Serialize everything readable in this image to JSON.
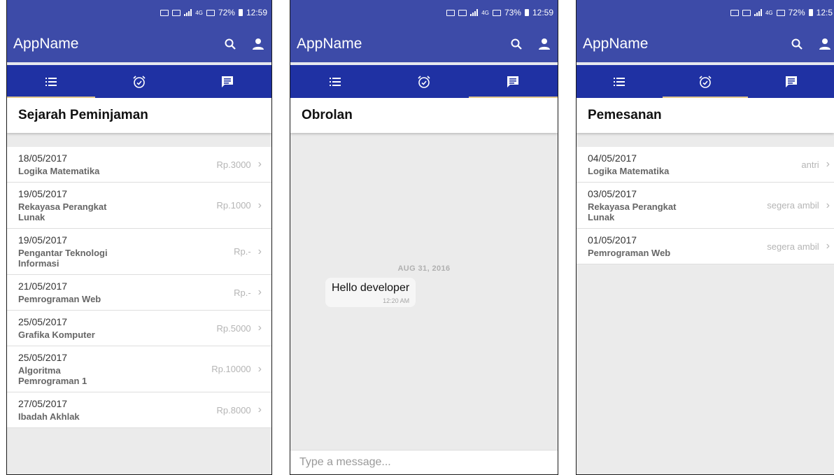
{
  "screens": [
    {
      "status": {
        "carrier": "4G",
        "battery": "72%",
        "time": "12:59"
      },
      "appbar": {
        "title": "AppName"
      },
      "tabs": [
        {
          "icon": "list-icon"
        },
        {
          "icon": "alarm-icon"
        },
        {
          "icon": "chat-icon"
        }
      ],
      "active_tab": 0,
      "section_title": "Sejarah Peminjaman",
      "items": [
        {
          "date": "18/05/2017",
          "title": "Logika Matematika",
          "value": "Rp.3000"
        },
        {
          "date": "19/05/2017",
          "title": "Rekayasa Perangkat Lunak",
          "value": "Rp.1000"
        },
        {
          "date": "19/05/2017",
          "title": "Pengantar Teknologi Informasi",
          "value": "Rp.-"
        },
        {
          "date": "21/05/2017",
          "title": "Pemrograman Web",
          "value": "Rp.-"
        },
        {
          "date": "25/05/2017",
          "title": "Grafika Komputer",
          "value": "Rp.5000"
        },
        {
          "date": "25/05/2017",
          "title": "Algoritma Pemrograman 1",
          "value": "Rp.10000"
        },
        {
          "date": "27/05/2017",
          "title": "Ibadah Akhlak",
          "value": "Rp.8000"
        }
      ]
    },
    {
      "status": {
        "carrier": "4G",
        "battery": "73%",
        "time": "12:59"
      },
      "appbar": {
        "title": "AppName"
      },
      "active_tab": 2,
      "section_title": "Obrolan",
      "chat": {
        "date_label": "AUG 31, 2016",
        "message": "Hello developer",
        "message_time": "12:20 AM",
        "input_placeholder": "Type a message..."
      }
    },
    {
      "status": {
        "carrier": "4G",
        "battery": "72%",
        "time": "12:5"
      },
      "appbar": {
        "title": "AppName"
      },
      "active_tab": 1,
      "section_title": "Pemesanan",
      "items": [
        {
          "date": "04/05/2017",
          "title": "Logika Matematika",
          "value": "antri"
        },
        {
          "date": "03/05/2017",
          "title": "Rekayasa Perangkat Lunak",
          "value": "segera ambil"
        },
        {
          "date": "01/05/2017",
          "title": "Pemrograman Web",
          "value": "segera ambil"
        }
      ]
    }
  ],
  "colors": {
    "appbar": "#3d4ba8",
    "tabbar": "#1f31a3",
    "tab_indicator": "#e3c98f"
  }
}
